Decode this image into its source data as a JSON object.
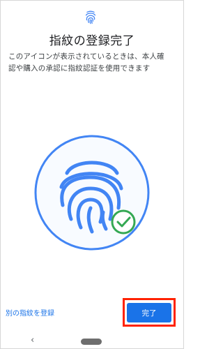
{
  "header": {
    "icon": "fingerprint-icon",
    "title": "指紋の登録完了"
  },
  "description": {
    "line1": "このアイコンが表示されているときは、本人確",
    "line2": "認や購入の承認に指紋認証を使用できます"
  },
  "hero": {
    "icon": "fingerprint-icon",
    "badge_icon": "check-circle-icon",
    "colors": {
      "accent": "#4285f4",
      "ring_fill": "#f8fbff",
      "check": "#34a853"
    }
  },
  "footer": {
    "secondary_link": "別の指紋を登録",
    "primary_button": "完了"
  },
  "navbar": {
    "back_glyph": "‹",
    "items": [
      "back-button",
      "home-button"
    ]
  }
}
